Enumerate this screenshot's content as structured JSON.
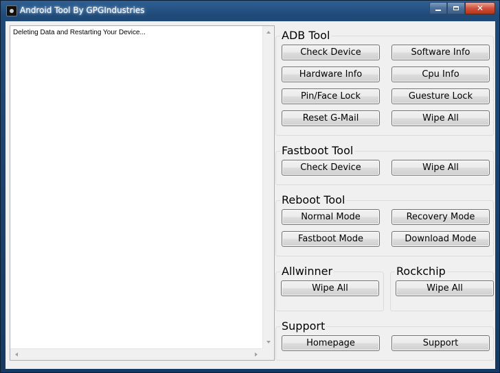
{
  "window": {
    "title": "Android Tool By GPGIndustries"
  },
  "log": {
    "text": "Deleting Data and Restarting Your Device..."
  },
  "adb": {
    "title": "ADB Tool",
    "buttons": [
      "Check Device",
      "Software Info",
      "Hardware Info",
      "Cpu Info",
      "Pin/Face Lock",
      "Guesture Lock",
      "Reset G-Mail",
      "Wipe All"
    ]
  },
  "fastboot": {
    "title": "Fastboot Tool",
    "buttons": [
      "Check Device",
      "Wipe All"
    ]
  },
  "reboot": {
    "title": "Reboot Tool",
    "buttons": [
      "Normal Mode",
      "Recovery Mode",
      "Fastboot Mode",
      "Download Mode"
    ]
  },
  "allwinner": {
    "title": "Allwinner",
    "buttons": [
      "Wipe All"
    ]
  },
  "rockchip": {
    "title": "Rockchip",
    "buttons": [
      "Wipe All"
    ]
  },
  "support": {
    "title": "Support",
    "buttons": [
      "Homepage",
      "Support"
    ]
  },
  "colors": {
    "title_bar": "#1f4a78",
    "client_bg": "#f0f0f0",
    "close_button": "#c7432b"
  }
}
